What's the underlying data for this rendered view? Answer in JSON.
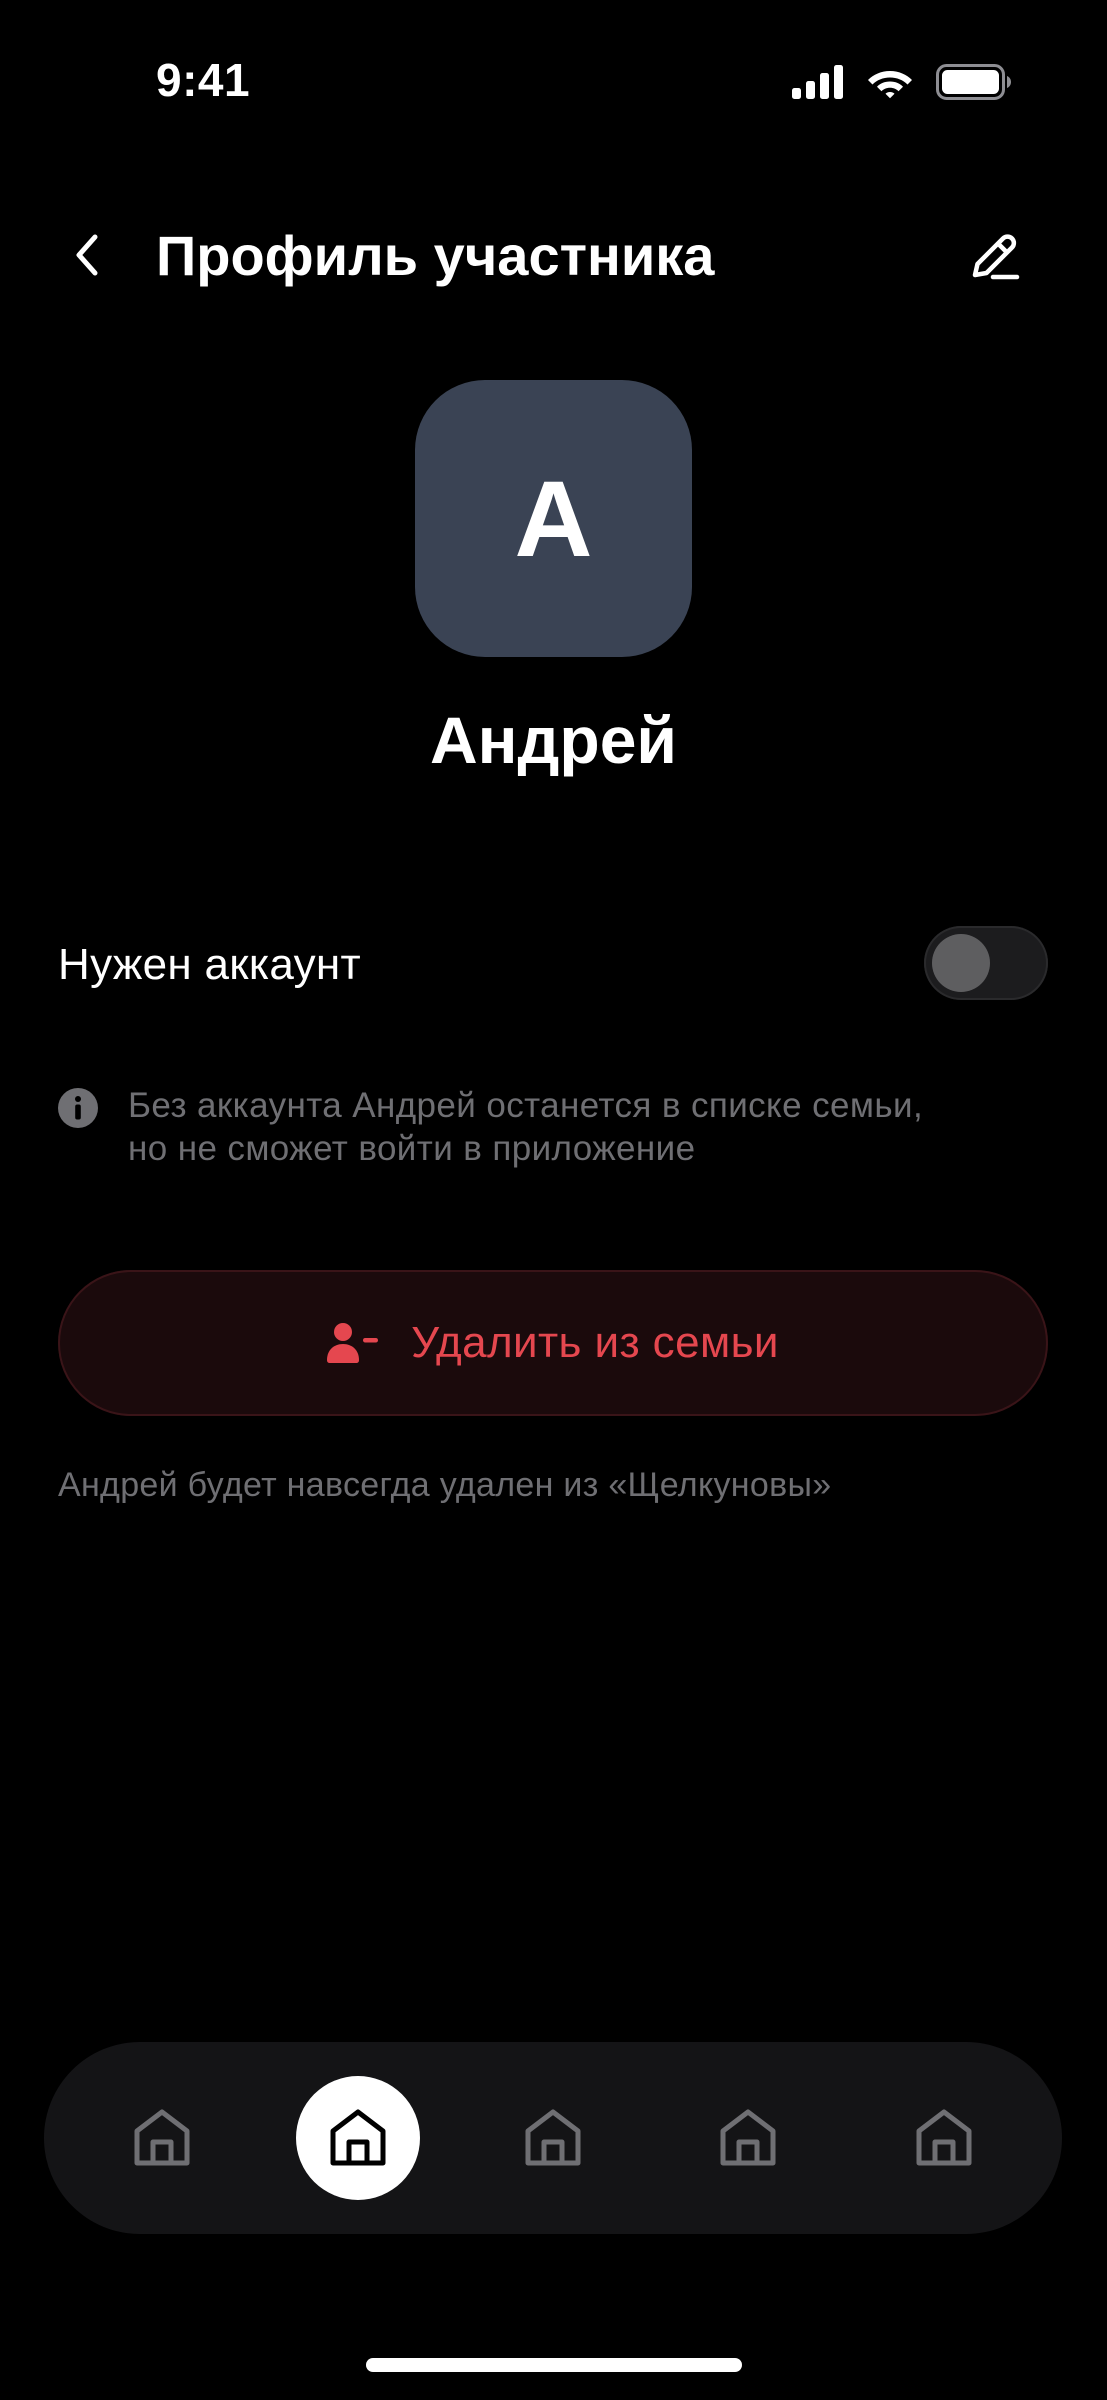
{
  "status_bar": {
    "time": "9:41"
  },
  "header": {
    "title": "Профиль участника"
  },
  "profile": {
    "avatar_letter": "А",
    "avatar_color": "#3a4354",
    "name": "Андрей"
  },
  "account": {
    "label": "Нужен аккаунт",
    "enabled": false
  },
  "info": {
    "line1": "Без аккаунта Андрей останется в списке семьи,",
    "line2": "но не сможет войти в приложение"
  },
  "remove": {
    "label": "Удалить из семьи",
    "caption": "Андрей будет навсегда удален из «Щелкуновы»",
    "color": "#e5474f"
  },
  "nav": {
    "active_index": 1,
    "items": [
      "home-icon",
      "home-icon",
      "home-icon",
      "home-icon",
      "home-icon"
    ]
  }
}
